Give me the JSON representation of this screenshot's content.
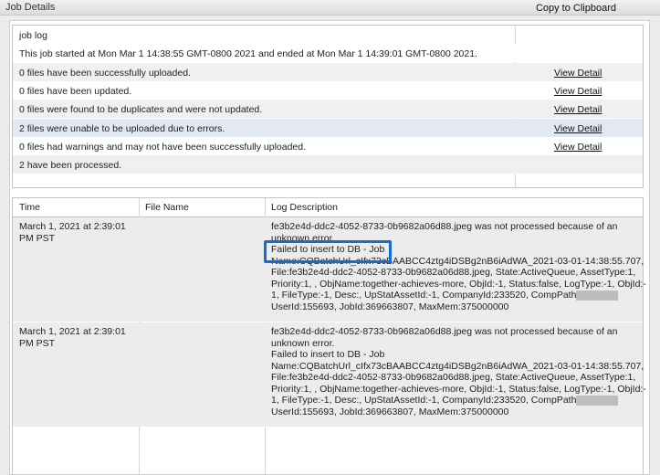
{
  "window": {
    "title": "Job Details",
    "copy_button": "Copy to Clipboard"
  },
  "job_log": {
    "header": "job log",
    "rows": [
      {
        "text": "This job started at Mon  Mar 1 14:38:55 GMT-0800 2021 and ended at Mon  Mar 1 14:39:01 GMT-0800 2021.",
        "link": ""
      },
      {
        "text": "0 files have been successfully uploaded.",
        "link": "View Detail"
      },
      {
        "text": "0 files have been updated.",
        "link": "View Detail"
      },
      {
        "text": "0 files were found to be duplicates and were not updated.",
        "link": "View Detail"
      },
      {
        "text": "2 files were unable to be uploaded due to errors.",
        "link": "View Detail"
      },
      {
        "text": "0 files had warnings and may not have been successfully uploaded.",
        "link": "View Detail"
      },
      {
        "text": "2 have been processed.",
        "link": ""
      }
    ]
  },
  "log_table": {
    "columns": [
      "Time",
      "File Name",
      "Log Description"
    ],
    "rows": [
      {
        "time_lines": [
          "March 1, 2021 at 2:39:01",
          "PM PST"
        ],
        "file_name": "",
        "desc_lines": [
          "fe3b2e4d-ddc2-4052-8733-0b9682a06d88.jpeg was not processed because of an",
          "unknown error.",
          "Failed to insert to DB - Job",
          "Name:CQBatchUrl_cIfx73cBAABCC4ztg4iDSBg2nB6iAdWA_2021-03-01-14:38:55.707,",
          "File:fe3b2e4d-ddc2-4052-8733-0b9682a06d88.jpeg, State:ActiveQueue, AssetType:1,",
          "Priority:1, , ObjName:together-achieves-more, ObjId:-1, Status:false, LogType:-1, ObjId:-",
          "1, FileType:-1, Desc:, UpStatAssetId:-1, CompanyId:233520, CompPath",
          "UserId:155693, JobId:369663807, MaxMem:375000000"
        ]
      },
      {
        "time_lines": [
          "March 1, 2021 at 2:39:01",
          "PM PST"
        ],
        "file_name": "",
        "desc_lines": [
          "fe3b2e4d-ddc2-4052-8733-0b9682a06d88.jpeg was not processed because of an",
          "unknown error.",
          "Failed to insert to DB - Job",
          "Name:CQBatchUrl_cIfx73cBAABCC4ztg4iDSBg2nB6iAdWA_2021-03-01-14:38:55.707,",
          "File:fe3b2e4d-ddc2-4052-8733-0b9682a06d88.jpeg, State:ActiveQueue, AssetType:1,",
          "Priority:1, , ObjName:together-achieves-more, ObjId:-1, Status:false, LogType:-1, ObjId:-",
          "1, FileType:-1, Desc:, UpStatAssetId:-1, CompanyId:233520, CompPath",
          "UserId:155693, JobId:369663807, MaxMem:375000000"
        ]
      }
    ]
  },
  "colors": {
    "row_highlight": "#e3e9f2",
    "row_stripe": "#f0f0f0",
    "highlight_box": "#1769d6"
  }
}
